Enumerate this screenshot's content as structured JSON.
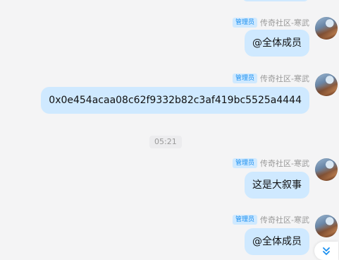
{
  "chat": {
    "messages": [
      {
        "badge": "管理员",
        "sender": "传奇社区-寒武",
        "text": "@全体成员"
      },
      {
        "badge": "管理员",
        "sender": "传奇社区-寒武",
        "text": "0x0e454acaa08c62f9332b82c3af419bc5525a4444"
      },
      {
        "badge": "管理员",
        "sender": "传奇社区-寒武",
        "text": "这是大叙事"
      },
      {
        "badge": "管理员",
        "sender": "传奇社区-寒武",
        "text": "@全体成员"
      }
    ],
    "timestamp": "05:21",
    "scroll_icon": "double-chevron-down-icon",
    "colors": {
      "bubble": "#cfe9ff",
      "badge_text": "#1a8ff0",
      "background": "#f4f4f5"
    }
  }
}
